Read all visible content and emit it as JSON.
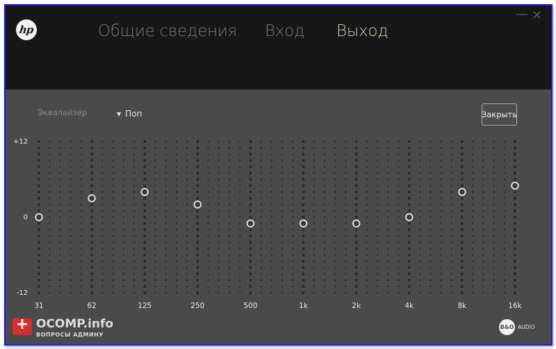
{
  "window": {
    "logo": "hp",
    "tabs": [
      {
        "label": "Общие сведения",
        "active": false
      },
      {
        "label": "Вход",
        "active": false
      },
      {
        "label": "Выход",
        "active": true
      }
    ],
    "minimize_icon": "minimize-icon",
    "close_icon": "close-icon",
    "minimize_glyph": "—",
    "close_glyph": "✕"
  },
  "equalizer": {
    "label": "Эквалайзер",
    "preset": {
      "selected": "Поп",
      "arrow_glyph": "▼"
    },
    "close_button": "Закрыть",
    "y_labels": {
      "top": "+12",
      "mid": "0",
      "bottom": "-12"
    },
    "y_range_db": [
      -12,
      12
    ],
    "bands": [
      {
        "label": "31",
        "gain_db": 0
      },
      {
        "label": "62",
        "gain_db": 3
      },
      {
        "label": "125",
        "gain_db": 4
      },
      {
        "label": "250",
        "gain_db": 2
      },
      {
        "label": "500",
        "gain_db": -1
      },
      {
        "label": "1k",
        "gain_db": -1
      },
      {
        "label": "2k",
        "gain_db": -1
      },
      {
        "label": "4k",
        "gain_db": 0
      },
      {
        "label": "8k",
        "gain_db": 4
      },
      {
        "label": "16k",
        "gain_db": 5
      }
    ],
    "colors": {
      "handle_stroke": "#e8e8e8",
      "grid_dot": "#2a2a2a",
      "background": "#4a4a4a"
    }
  },
  "branding": {
    "bo_logo": "B&O",
    "bo_text": "AUDIO"
  },
  "watermark": {
    "title": "OCOMP.info",
    "subtitle": "ВОПРОСЫ АДМИНУ"
  }
}
